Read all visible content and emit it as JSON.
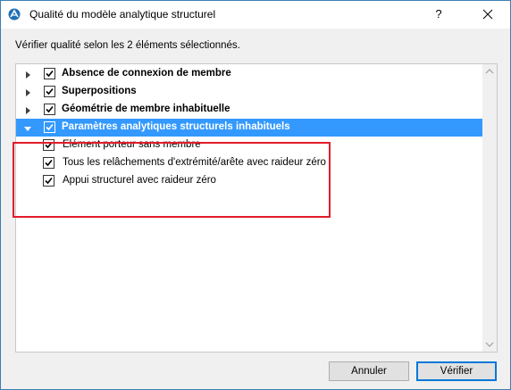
{
  "window": {
    "title": "Qualité du modèle analytique structurel",
    "help_label": "?",
    "accent_color": "#3399ff",
    "highlight_color": "#e21c2a"
  },
  "instructions": "Vérifier qualité selon les 2 éléments sélectionnés.",
  "tree": {
    "items": [
      {
        "label": "Absence de connexion de membre",
        "checked": true,
        "expanded": false,
        "level": 0,
        "selected": false
      },
      {
        "label": "Superpositions",
        "checked": true,
        "expanded": false,
        "level": 0,
        "selected": false
      },
      {
        "label": "Géométrie de membre inhabituelle",
        "checked": true,
        "expanded": false,
        "level": 0,
        "selected": false
      },
      {
        "label": "Paramètres analytiques structurels inhabituels",
        "checked": true,
        "expanded": true,
        "level": 0,
        "selected": true
      },
      {
        "label": "Elément porteur sans membre",
        "checked": true,
        "level": 1,
        "selected": false
      },
      {
        "label": "Tous les relâchements d'extrémité/arête avec raideur zéro",
        "checked": true,
        "level": 1,
        "selected": false
      },
      {
        "label": "Appui structurel avec raideur zéro",
        "checked": true,
        "level": 1,
        "selected": false
      }
    ]
  },
  "buttons": {
    "cancel_label": "Annuler",
    "verify_label": "Vérifier"
  }
}
